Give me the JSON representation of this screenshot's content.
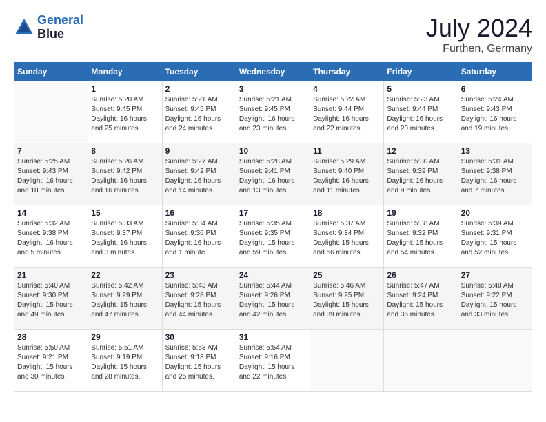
{
  "header": {
    "logo_line1": "General",
    "logo_line2": "Blue",
    "month_year": "July 2024",
    "location": "Furthen, Germany"
  },
  "days_of_week": [
    "Sunday",
    "Monday",
    "Tuesday",
    "Wednesday",
    "Thursday",
    "Friday",
    "Saturday"
  ],
  "weeks": [
    [
      {
        "day": "",
        "info": ""
      },
      {
        "day": "1",
        "info": "Sunrise: 5:20 AM\nSunset: 9:45 PM\nDaylight: 16 hours\nand 25 minutes."
      },
      {
        "day": "2",
        "info": "Sunrise: 5:21 AM\nSunset: 9:45 PM\nDaylight: 16 hours\nand 24 minutes."
      },
      {
        "day": "3",
        "info": "Sunrise: 5:21 AM\nSunset: 9:45 PM\nDaylight: 16 hours\nand 23 minutes."
      },
      {
        "day": "4",
        "info": "Sunrise: 5:22 AM\nSunset: 9:44 PM\nDaylight: 16 hours\nand 22 minutes."
      },
      {
        "day": "5",
        "info": "Sunrise: 5:23 AM\nSunset: 9:44 PM\nDaylight: 16 hours\nand 20 minutes."
      },
      {
        "day": "6",
        "info": "Sunrise: 5:24 AM\nSunset: 9:43 PM\nDaylight: 16 hours\nand 19 minutes."
      }
    ],
    [
      {
        "day": "7",
        "info": "Sunrise: 5:25 AM\nSunset: 9:43 PM\nDaylight: 16 hours\nand 18 minutes."
      },
      {
        "day": "8",
        "info": "Sunrise: 5:26 AM\nSunset: 9:42 PM\nDaylight: 16 hours\nand 16 minutes."
      },
      {
        "day": "9",
        "info": "Sunrise: 5:27 AM\nSunset: 9:42 PM\nDaylight: 16 hours\nand 14 minutes."
      },
      {
        "day": "10",
        "info": "Sunrise: 5:28 AM\nSunset: 9:41 PM\nDaylight: 16 hours\nand 13 minutes."
      },
      {
        "day": "11",
        "info": "Sunrise: 5:29 AM\nSunset: 9:40 PM\nDaylight: 16 hours\nand 11 minutes."
      },
      {
        "day": "12",
        "info": "Sunrise: 5:30 AM\nSunset: 9:39 PM\nDaylight: 16 hours\nand 9 minutes."
      },
      {
        "day": "13",
        "info": "Sunrise: 5:31 AM\nSunset: 9:38 PM\nDaylight: 16 hours\nand 7 minutes."
      }
    ],
    [
      {
        "day": "14",
        "info": "Sunrise: 5:32 AM\nSunset: 9:38 PM\nDaylight: 16 hours\nand 5 minutes."
      },
      {
        "day": "15",
        "info": "Sunrise: 5:33 AM\nSunset: 9:37 PM\nDaylight: 16 hours\nand 3 minutes."
      },
      {
        "day": "16",
        "info": "Sunrise: 5:34 AM\nSunset: 9:36 PM\nDaylight: 16 hours\nand 1 minute."
      },
      {
        "day": "17",
        "info": "Sunrise: 5:35 AM\nSunset: 9:35 PM\nDaylight: 15 hours\nand 59 minutes."
      },
      {
        "day": "18",
        "info": "Sunrise: 5:37 AM\nSunset: 9:34 PM\nDaylight: 15 hours\nand 56 minutes."
      },
      {
        "day": "19",
        "info": "Sunrise: 5:38 AM\nSunset: 9:32 PM\nDaylight: 15 hours\nand 54 minutes."
      },
      {
        "day": "20",
        "info": "Sunrise: 5:39 AM\nSunset: 9:31 PM\nDaylight: 15 hours\nand 52 minutes."
      }
    ],
    [
      {
        "day": "21",
        "info": "Sunrise: 5:40 AM\nSunset: 9:30 PM\nDaylight: 15 hours\nand 49 minutes."
      },
      {
        "day": "22",
        "info": "Sunrise: 5:42 AM\nSunset: 9:29 PM\nDaylight: 15 hours\nand 47 minutes."
      },
      {
        "day": "23",
        "info": "Sunrise: 5:43 AM\nSunset: 9:28 PM\nDaylight: 15 hours\nand 44 minutes."
      },
      {
        "day": "24",
        "info": "Sunrise: 5:44 AM\nSunset: 9:26 PM\nDaylight: 15 hours\nand 42 minutes."
      },
      {
        "day": "25",
        "info": "Sunrise: 5:46 AM\nSunset: 9:25 PM\nDaylight: 15 hours\nand 39 minutes."
      },
      {
        "day": "26",
        "info": "Sunrise: 5:47 AM\nSunset: 9:24 PM\nDaylight: 15 hours\nand 36 minutes."
      },
      {
        "day": "27",
        "info": "Sunrise: 5:48 AM\nSunset: 9:22 PM\nDaylight: 15 hours\nand 33 minutes."
      }
    ],
    [
      {
        "day": "28",
        "info": "Sunrise: 5:50 AM\nSunset: 9:21 PM\nDaylight: 15 hours\nand 30 minutes."
      },
      {
        "day": "29",
        "info": "Sunrise: 5:51 AM\nSunset: 9:19 PM\nDaylight: 15 hours\nand 28 minutes."
      },
      {
        "day": "30",
        "info": "Sunrise: 5:53 AM\nSunset: 9:18 PM\nDaylight: 15 hours\nand 25 minutes."
      },
      {
        "day": "31",
        "info": "Sunrise: 5:54 AM\nSunset: 9:16 PM\nDaylight: 15 hours\nand 22 minutes."
      },
      {
        "day": "",
        "info": ""
      },
      {
        "day": "",
        "info": ""
      },
      {
        "day": "",
        "info": ""
      }
    ]
  ]
}
